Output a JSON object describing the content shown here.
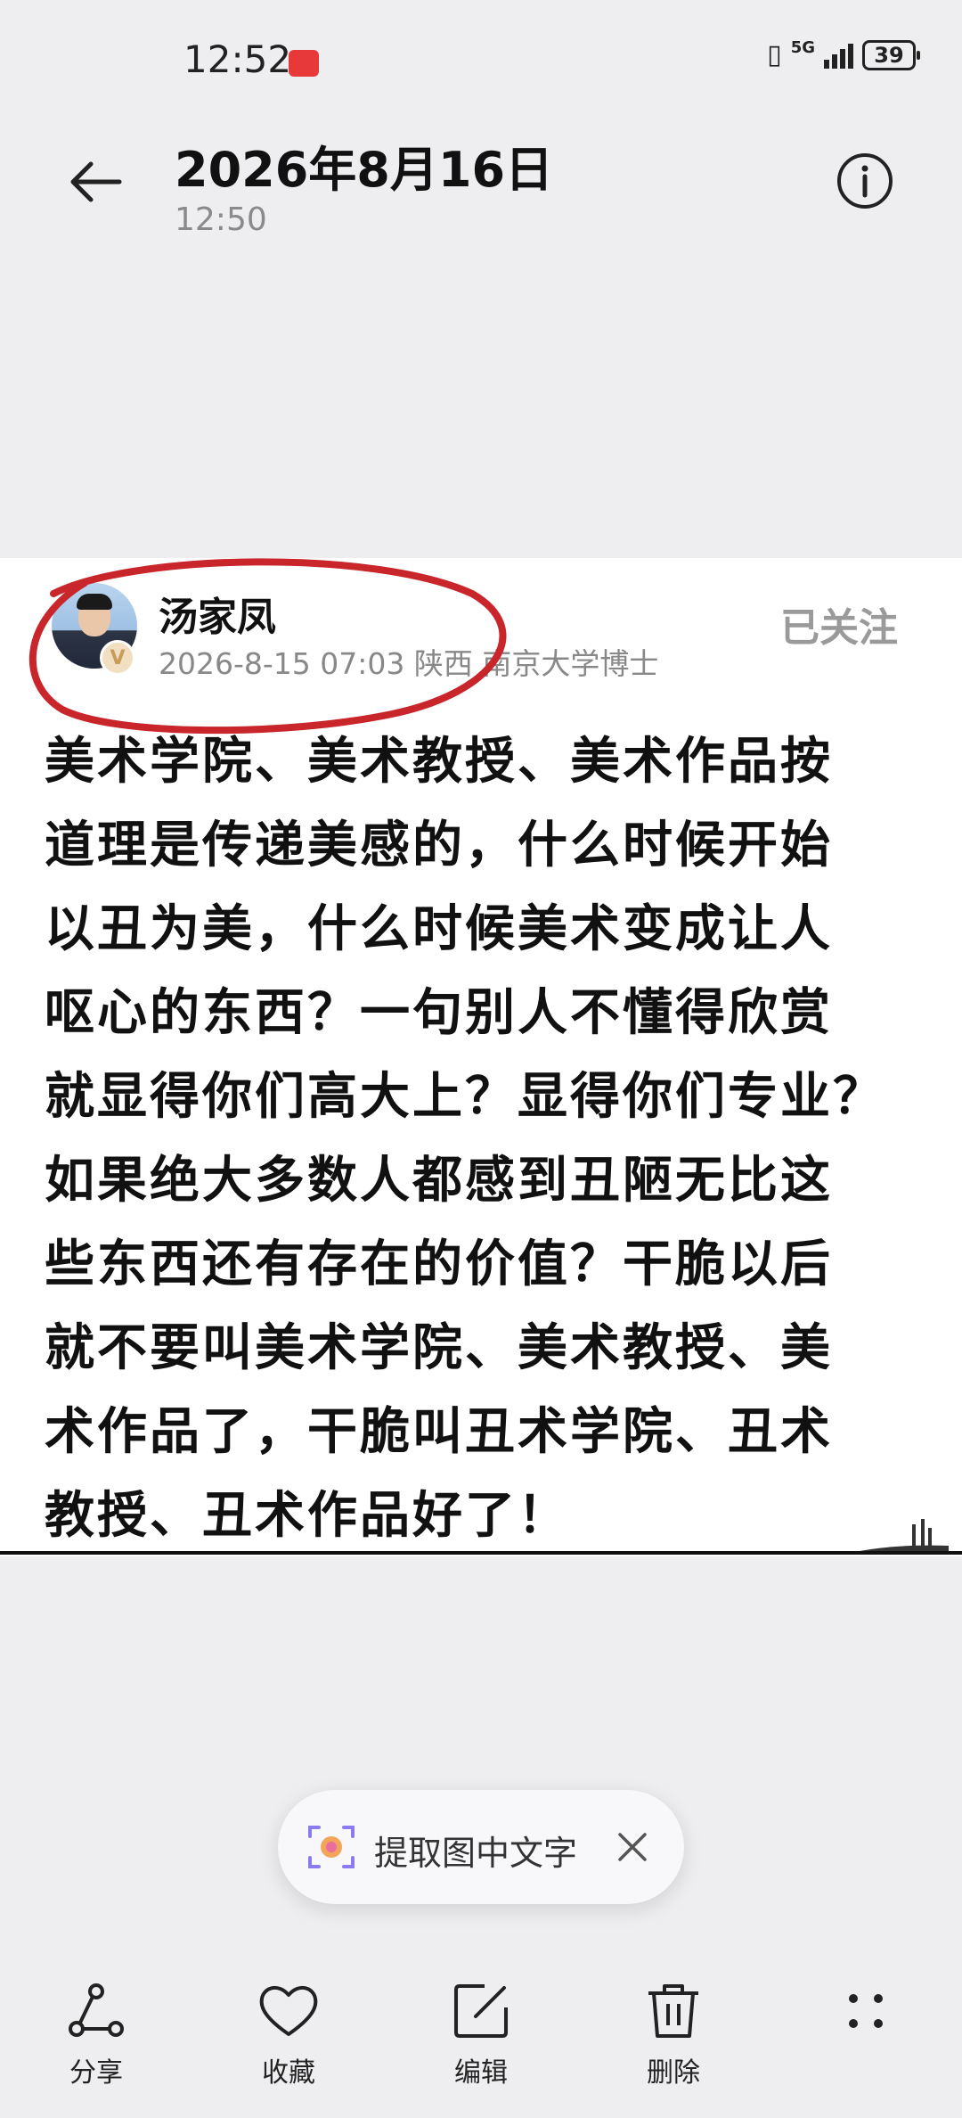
{
  "status_bar": {
    "time": "12:52",
    "network": "5G",
    "battery": "39"
  },
  "header": {
    "date": "2026年8月16日",
    "time": "12:50"
  },
  "post": {
    "author": "汤家凤",
    "avatar_badge": "V",
    "meta": "2026-8-15 07:03 陕西 南京大学博士",
    "follow_status": "已关注",
    "lines": [
      "美术学院、美术教授、美术作品按",
      "道理是传递美感的，什么时候开始",
      "以丑为美，什么时候美术变成让人",
      "呕心的东西？一句别人不懂得欣赏",
      "就显得你们高大上？显得你们专业？",
      "如果绝大多数人都感到丑陋无比这",
      "些东西还有存在的价值？干脆以后",
      "就不要叫美术学院、美术教授、美",
      "术作品了，干脆叫丑术学院、丑术",
      "教授、丑术作品好了！"
    ]
  },
  "ocr_pill": {
    "label": "提取图中文字"
  },
  "toolbar": {
    "share": "分享",
    "favorite": "收藏",
    "edit": "编辑",
    "delete": "删除"
  },
  "colors": {
    "background": "#eeeef0",
    "annotation_circle": "#c8262b",
    "huawei_badge": "#e8393a"
  }
}
